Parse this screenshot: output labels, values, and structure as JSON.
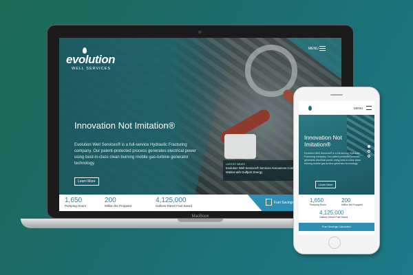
{
  "site": {
    "logo_text": "evolution",
    "logo_sub": "WELL SERVICES",
    "menu_label": "MENU",
    "hero_title": "Innovation Not Imitation®",
    "hero_body": "Evolution Well Services® is a full-service Hydraulic Fracturing company. Our patent-protected process generates electrical power using best-in-class clean burning mobile gas-turbine generator technology.",
    "learn_more": "Learn More",
    "news_label": "LATEST NEWS",
    "news_text": "Evolution Well Services® Services Announces Commitment to Northeastern U.S. Market with Gulfport Energy",
    "fuel_button": "Fuel Savings Calculator",
    "stats": [
      {
        "value": "1,650",
        "label": "Pumping Hours"
      },
      {
        "value": "200",
        "label": "Million lbs Proppant"
      },
      {
        "value": "4,125,000",
        "label": "Gallons Diesel Fuel Saved"
      }
    ]
  },
  "device": {
    "laptop_brand": "MacBook"
  },
  "colors": {
    "teal": "#1e646c",
    "accent_blue": "#2f8fb3",
    "stat_blue": "#2a7fa0"
  }
}
